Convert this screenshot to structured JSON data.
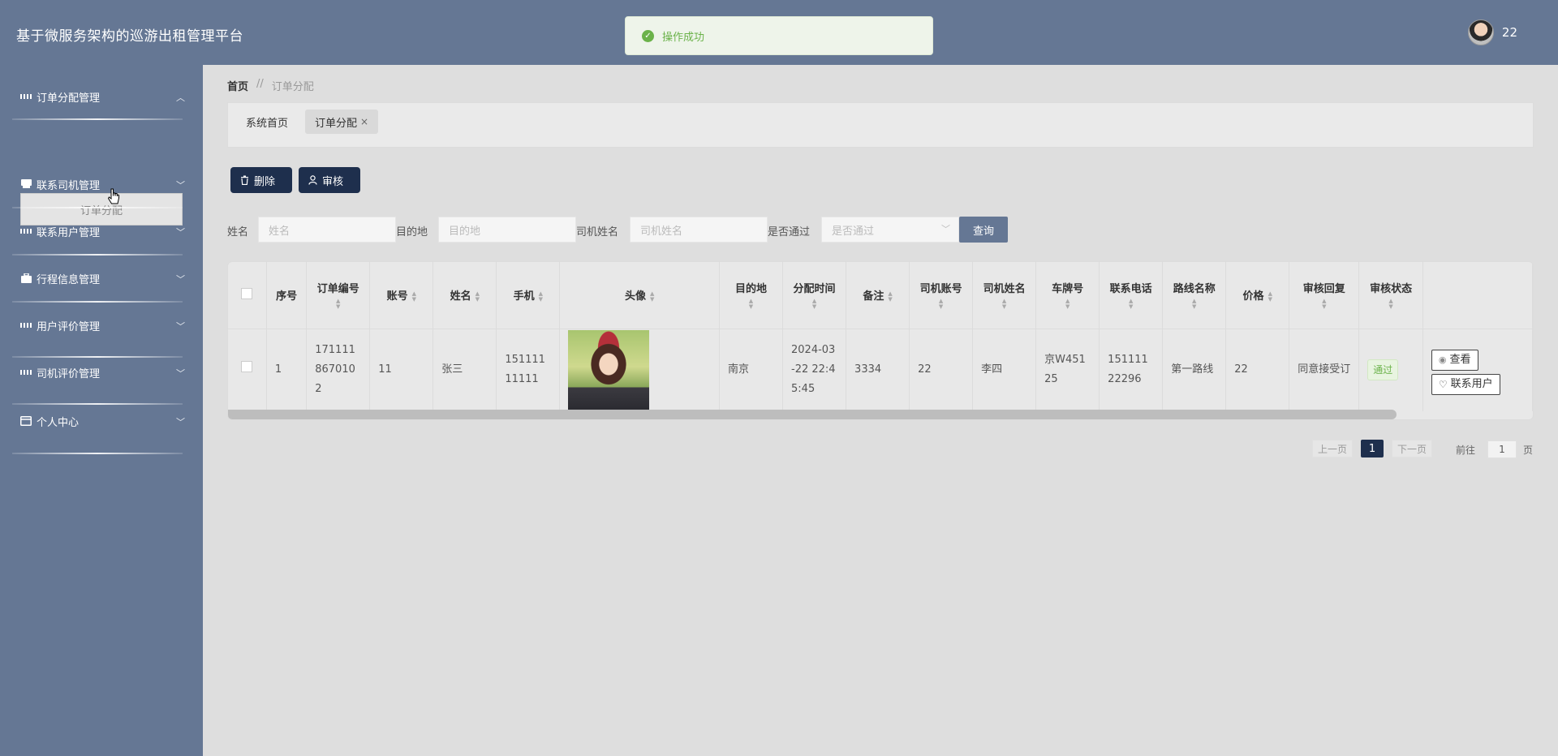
{
  "header": {
    "app_title": "基于微服务架构的巡游出租管理平台",
    "username": "22"
  },
  "toast": {
    "message": "操作成功"
  },
  "sidebar": {
    "items": [
      {
        "label": "订单分配管理",
        "icon": "grid-icon",
        "expanded": true
      },
      {
        "label": "联系司机管理",
        "icon": "chat-icon",
        "expanded": false
      },
      {
        "label": "联系用户管理",
        "icon": "grid-icon",
        "expanded": false
      },
      {
        "label": "行程信息管理",
        "icon": "briefcase-icon",
        "expanded": false
      },
      {
        "label": "用户评价管理",
        "icon": "grid-icon",
        "expanded": false
      },
      {
        "label": "司机评价管理",
        "icon": "grid-icon",
        "expanded": false
      },
      {
        "label": "个人中心",
        "icon": "card-icon",
        "expanded": false
      }
    ],
    "submenu": {
      "label": "订单分配"
    }
  },
  "breadcrumb": {
    "home": "首页",
    "separator": "//",
    "current": "订单分配"
  },
  "tabs": [
    {
      "label": "系统首页"
    },
    {
      "label": "订单分配",
      "close": "×"
    }
  ],
  "toolbar": {
    "delete_label": "删除",
    "audit_label": "审核"
  },
  "search": {
    "name_label": "姓名",
    "name_placeholder": "姓名",
    "dest_label": "目的地",
    "dest_placeholder": "目的地",
    "driver_label": "司机姓名",
    "driver_placeholder": "司机姓名",
    "pass_label": "是否通过",
    "pass_placeholder": "是否通过",
    "query_label": "查询"
  },
  "table": {
    "headers": {
      "index": "序号",
      "order_no": "订单编号",
      "account": "账号",
      "name": "姓名",
      "phone": "手机",
      "avatar": "头像",
      "destination": "目的地",
      "assign_time": "分配时间",
      "remark": "备注",
      "driver_account": "司机账号",
      "driver_name": "司机姓名",
      "plate": "车牌号",
      "contact_phone": "联系电话",
      "route": "路线名称",
      "price": "价格",
      "audit_reply": "审核回复",
      "audit_status": "审核状态"
    },
    "rows": [
      {
        "index": "1",
        "order_no": "1711118670102",
        "account": "11",
        "name": "张三",
        "phone": "15111111111",
        "destination": "南京",
        "assign_time": "2024-03-22 22:45:45",
        "remark": "3334",
        "driver_account": "22",
        "driver_name": "李四",
        "plate": "京W45125",
        "contact_phone": "15111122296",
        "route": "第一路线",
        "price": "22",
        "audit_reply": "同意接受订",
        "audit_status": "通过",
        "view_label": "查看",
        "contact_label": "联系用户"
      }
    ]
  },
  "pagination": {
    "prev": "上一页",
    "current": "1",
    "next": "下一页",
    "goto_label": "前往",
    "goto_value": "1",
    "page_suffix": "页"
  },
  "colors": {
    "header_bg": "#657794",
    "sidebar_bg": "#657794",
    "primary_dark": "#1e2f4d",
    "success": "#6bb24a"
  }
}
